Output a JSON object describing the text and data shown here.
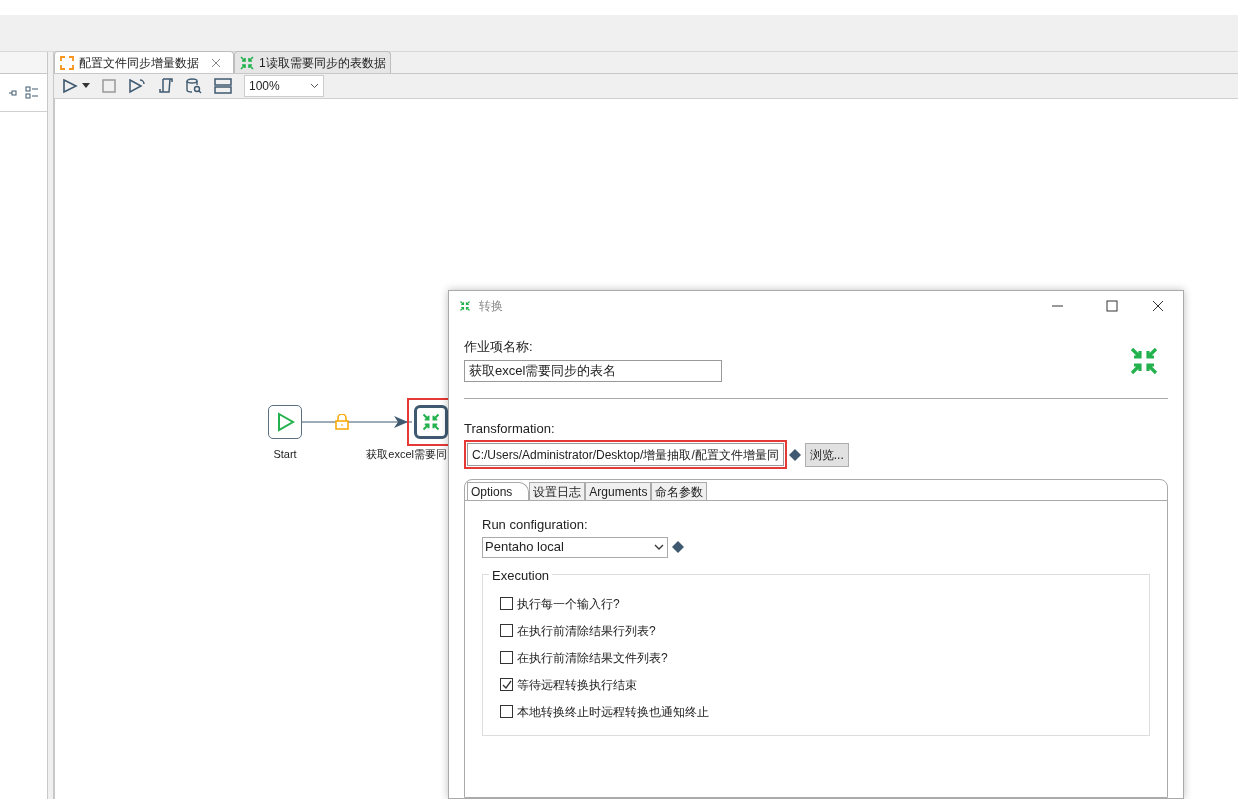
{
  "editor_tabs": [
    {
      "label": "配置文件同步增量数据",
      "selected": true,
      "kind": "job",
      "closable": true
    },
    {
      "label": "1读取需要同步的表数据",
      "selected": false,
      "kind": "transformation",
      "closable": false
    }
  ],
  "toolbar": {
    "zoom": "100%"
  },
  "canvas": {
    "nodes": [
      {
        "kind": "start",
        "label": "Start",
        "highlighted": false
      },
      {
        "kind": "transformation",
        "label": "获取excel需要同",
        "highlighted": true
      }
    ],
    "hop": {
      "locked": true
    }
  },
  "dialog": {
    "title": "转换",
    "name_label": "作业项名称:",
    "name_value": "获取excel需要同步的表名",
    "transformation_label": "Transformation:",
    "transformation_value": "C:/Users/Administrator/Desktop/增量抽取/配置文件增量同",
    "transformation_highlighted": true,
    "browse": "浏览...",
    "tabs": [
      {
        "label": "Options",
        "selected": true
      },
      {
        "label": "设置日志",
        "selected": false
      },
      {
        "label": "Arguments",
        "selected": false
      },
      {
        "label": "命名参数",
        "selected": false
      }
    ],
    "run_config_label": "Run configuration:",
    "run_config_value": "Pentaho local",
    "group_label": "Execution",
    "options": [
      {
        "label": "执行每一个输入行?",
        "checked": false
      },
      {
        "label": "在执行前清除结果行列表?",
        "checked": false
      },
      {
        "label": "在执行前清除结果文件列表?",
        "checked": false
      },
      {
        "label": "等待远程转换执行结束",
        "checked": true
      },
      {
        "label": "本地转换终止时远程转换也通知终止",
        "checked": false
      }
    ]
  }
}
